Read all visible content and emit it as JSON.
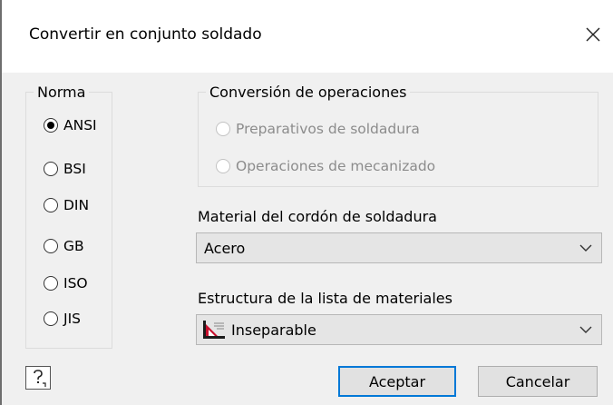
{
  "dialog": {
    "title": "Convertir en conjunto soldado"
  },
  "norma": {
    "legend": "Norma",
    "options": [
      {
        "label": "ANSI",
        "checked": true
      },
      {
        "label": "BSI",
        "checked": false
      },
      {
        "label": "DIN",
        "checked": false
      },
      {
        "label": "GB",
        "checked": false
      },
      {
        "label": "ISO",
        "checked": false
      },
      {
        "label": "JIS",
        "checked": false
      }
    ]
  },
  "conversion": {
    "legend": "Conversión de operaciones",
    "options": [
      {
        "label": "Preparativos de soldadura",
        "enabled": false
      },
      {
        "label": "Operaciones de mecanizado",
        "enabled": false
      }
    ]
  },
  "weld_material": {
    "label": "Material del cordón de soldadura",
    "value": "Acero"
  },
  "bom_structure": {
    "label": "Estructura de la lista de materiales",
    "value": "Inseparable",
    "icon": "inseparable-structure-icon"
  },
  "buttons": {
    "ok": "Aceptar",
    "cancel": "Cancelar",
    "help_icon": "help-icon",
    "close_icon": "close-icon"
  },
  "colors": {
    "content_bg": "#f0f0f0",
    "accent": "#0078d7",
    "disabled_text": "#8c8c8c"
  }
}
